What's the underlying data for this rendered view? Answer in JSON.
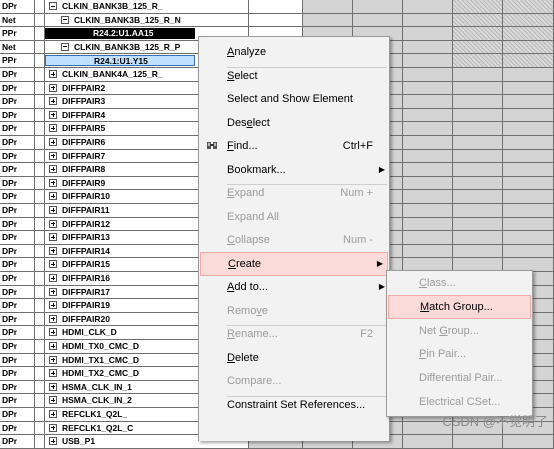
{
  "rows": [
    {
      "type": "DPr",
      "expand": "minus",
      "indent": 1,
      "label": "CLKIN_BANK3B_125_R_",
      "style": "normal"
    },
    {
      "type": "Net",
      "expand": "minus",
      "indent": 2,
      "label": "CLKIN_BANK3B_125_R_N",
      "style": "normal"
    },
    {
      "type": "PPr",
      "expand": "none",
      "indent": 0,
      "label": "R24.2:U1.AA15",
      "style": "black"
    },
    {
      "type": "Net",
      "expand": "minus",
      "indent": 2,
      "label": "CLKIN_BANK3B_125_R_P",
      "style": "normal"
    },
    {
      "type": "PPr",
      "expand": "none",
      "indent": 0,
      "label": "R24.1:U1.Y15",
      "style": "blue"
    },
    {
      "type": "DPr",
      "expand": "plus",
      "indent": 1,
      "label": "CLKIN_BANK4A_125_R_",
      "style": "normal"
    },
    {
      "type": "DPr",
      "expand": "plus",
      "indent": 1,
      "label": "DIFFPAIR2",
      "style": "normal"
    },
    {
      "type": "DPr",
      "expand": "plus",
      "indent": 1,
      "label": "DIFFPAIR3",
      "style": "normal"
    },
    {
      "type": "DPr",
      "expand": "plus",
      "indent": 1,
      "label": "DIFFPAIR4",
      "style": "normal"
    },
    {
      "type": "DPr",
      "expand": "plus",
      "indent": 1,
      "label": "DIFFPAIR5",
      "style": "normal"
    },
    {
      "type": "DPr",
      "expand": "plus",
      "indent": 1,
      "label": "DIFFPAIR6",
      "style": "normal"
    },
    {
      "type": "DPr",
      "expand": "plus",
      "indent": 1,
      "label": "DIFFPAIR7",
      "style": "normal"
    },
    {
      "type": "DPr",
      "expand": "plus",
      "indent": 1,
      "label": "DIFFPAIR8",
      "style": "normal"
    },
    {
      "type": "DPr",
      "expand": "plus",
      "indent": 1,
      "label": "DIFFPAIR9",
      "style": "normal"
    },
    {
      "type": "DPr",
      "expand": "plus",
      "indent": 1,
      "label": "DIFFPAIR10",
      "style": "normal"
    },
    {
      "type": "DPr",
      "expand": "plus",
      "indent": 1,
      "label": "DIFFPAIR11",
      "style": "normal"
    },
    {
      "type": "DPr",
      "expand": "plus",
      "indent": 1,
      "label": "DIFFPAIR12",
      "style": "normal"
    },
    {
      "type": "DPr",
      "expand": "plus",
      "indent": 1,
      "label": "DIFFPAIR13",
      "style": "normal"
    },
    {
      "type": "DPr",
      "expand": "plus",
      "indent": 1,
      "label": "DIFFPAIR14",
      "style": "normal"
    },
    {
      "type": "DPr",
      "expand": "plus",
      "indent": 1,
      "label": "DIFFPAIR15",
      "style": "normal"
    },
    {
      "type": "DPr",
      "expand": "plus",
      "indent": 1,
      "label": "DIFFPAIR16",
      "style": "normal"
    },
    {
      "type": "DPr",
      "expand": "plus",
      "indent": 1,
      "label": "DIFFPAIR17",
      "style": "normal"
    },
    {
      "type": "DPr",
      "expand": "plus",
      "indent": 1,
      "label": "DIFFPAIR19",
      "style": "normal"
    },
    {
      "type": "DPr",
      "expand": "plus",
      "indent": 1,
      "label": "DIFFPAIR20",
      "style": "normal"
    },
    {
      "type": "DPr",
      "expand": "plus",
      "indent": 1,
      "label": "HDMI_CLK_D",
      "style": "normal"
    },
    {
      "type": "DPr",
      "expand": "plus",
      "indent": 1,
      "label": "HDMI_TX0_CMC_D",
      "style": "normal"
    },
    {
      "type": "DPr",
      "expand": "plus",
      "indent": 1,
      "label": "HDMI_TX1_CMC_D",
      "style": "normal"
    },
    {
      "type": "DPr",
      "expand": "plus",
      "indent": 1,
      "label": "HDMI_TX2_CMC_D",
      "style": "normal"
    },
    {
      "type": "DPr",
      "expand": "plus",
      "indent": 1,
      "label": "HSMA_CLK_IN_1",
      "style": "normal"
    },
    {
      "type": "DPr",
      "expand": "plus",
      "indent": 1,
      "label": "HSMA_CLK_IN_2",
      "style": "normal"
    },
    {
      "type": "DPr",
      "expand": "plus",
      "indent": 1,
      "label": "REFCLK1_Q2L_",
      "style": "normal"
    },
    {
      "type": "DPr",
      "expand": "plus",
      "indent": 1,
      "label": "REFCLK1_Q2L_C",
      "style": "normal"
    },
    {
      "type": "DPr",
      "expand": "plus",
      "indent": 1,
      "label": "USB_P1",
      "style": "normal"
    }
  ],
  "context_menu": {
    "items": [
      {
        "id": "analyze",
        "label": "Analyze",
        "u": 0,
        "shortcut": "",
        "enabled": true
      },
      {
        "sep": true
      },
      {
        "id": "select",
        "label": "Select",
        "u": 0,
        "shortcut": "",
        "enabled": true
      },
      {
        "id": "select-show",
        "label": "Select and Show Element",
        "u": -1,
        "shortcut": "",
        "enabled": true
      },
      {
        "id": "deselect",
        "label": "Deselect",
        "u": 3,
        "shortcut": "",
        "enabled": true
      },
      {
        "id": "find",
        "label": "Find...",
        "u": 0,
        "shortcut": "Ctrl+F",
        "enabled": true,
        "icon": "find-icon"
      },
      {
        "id": "bookmark",
        "label": "Bookmark...",
        "u": -1,
        "shortcut": "",
        "enabled": true,
        "submenu": true
      },
      {
        "sep": true
      },
      {
        "id": "expand",
        "label": "Expand",
        "u": 0,
        "shortcut": "Num +",
        "enabled": false
      },
      {
        "id": "expand-all",
        "label": "Expand All",
        "u": -1,
        "shortcut": "",
        "enabled": false
      },
      {
        "id": "collapse",
        "label": "Collapse",
        "u": 0,
        "shortcut": "Num -",
        "enabled": false
      },
      {
        "sep": true
      },
      {
        "id": "create",
        "label": "Create",
        "u": 0,
        "shortcut": "",
        "enabled": true,
        "submenu": true,
        "highlight": true
      },
      {
        "id": "add-to",
        "label": "Add to...",
        "u": 0,
        "shortcut": "",
        "enabled": true,
        "submenu": true
      },
      {
        "id": "remove",
        "label": "Remove",
        "u": 4,
        "shortcut": "",
        "enabled": false
      },
      {
        "sep": true
      },
      {
        "id": "rename",
        "label": "Rename...",
        "u": 0,
        "shortcut": "F2",
        "enabled": false
      },
      {
        "id": "delete",
        "label": "Delete",
        "u": 0,
        "shortcut": "",
        "enabled": true
      },
      {
        "id": "compare",
        "label": "Compare...",
        "u": -1,
        "shortcut": "",
        "enabled": false
      },
      {
        "sep": true
      },
      {
        "id": "constraint-set-refs",
        "label": "Constraint Set References...",
        "u": -1,
        "shortcut": "",
        "enabled": true
      }
    ]
  },
  "create_submenu": {
    "items": [
      {
        "id": "class",
        "label": "Class...",
        "u": 0,
        "enabled": false
      },
      {
        "sep": true
      },
      {
        "id": "match-group",
        "label": "Match Group...",
        "u": 0,
        "enabled": true,
        "highlight": true
      },
      {
        "id": "net-group",
        "label": "Net Group...",
        "u": 4,
        "enabled": false
      },
      {
        "id": "pin-pair",
        "label": "Pin Pair...",
        "u": 0,
        "enabled": false
      },
      {
        "id": "differential-pair",
        "label": "Differential Pair...",
        "u": -1,
        "enabled": false
      },
      {
        "id": "electrical-cset",
        "label": "Electrical CSet...",
        "u": -1,
        "enabled": false
      }
    ]
  },
  "watermark": "CSDN @不觉明了",
  "colors": {
    "menu_bg": "#f2f2f2",
    "highlight_bg": "#fbdada",
    "highlight_border": "#f0a8a8",
    "selected_black": "#000000",
    "selected_blue": "#bfe0ff",
    "grid_grey": "#d4d4d4"
  }
}
